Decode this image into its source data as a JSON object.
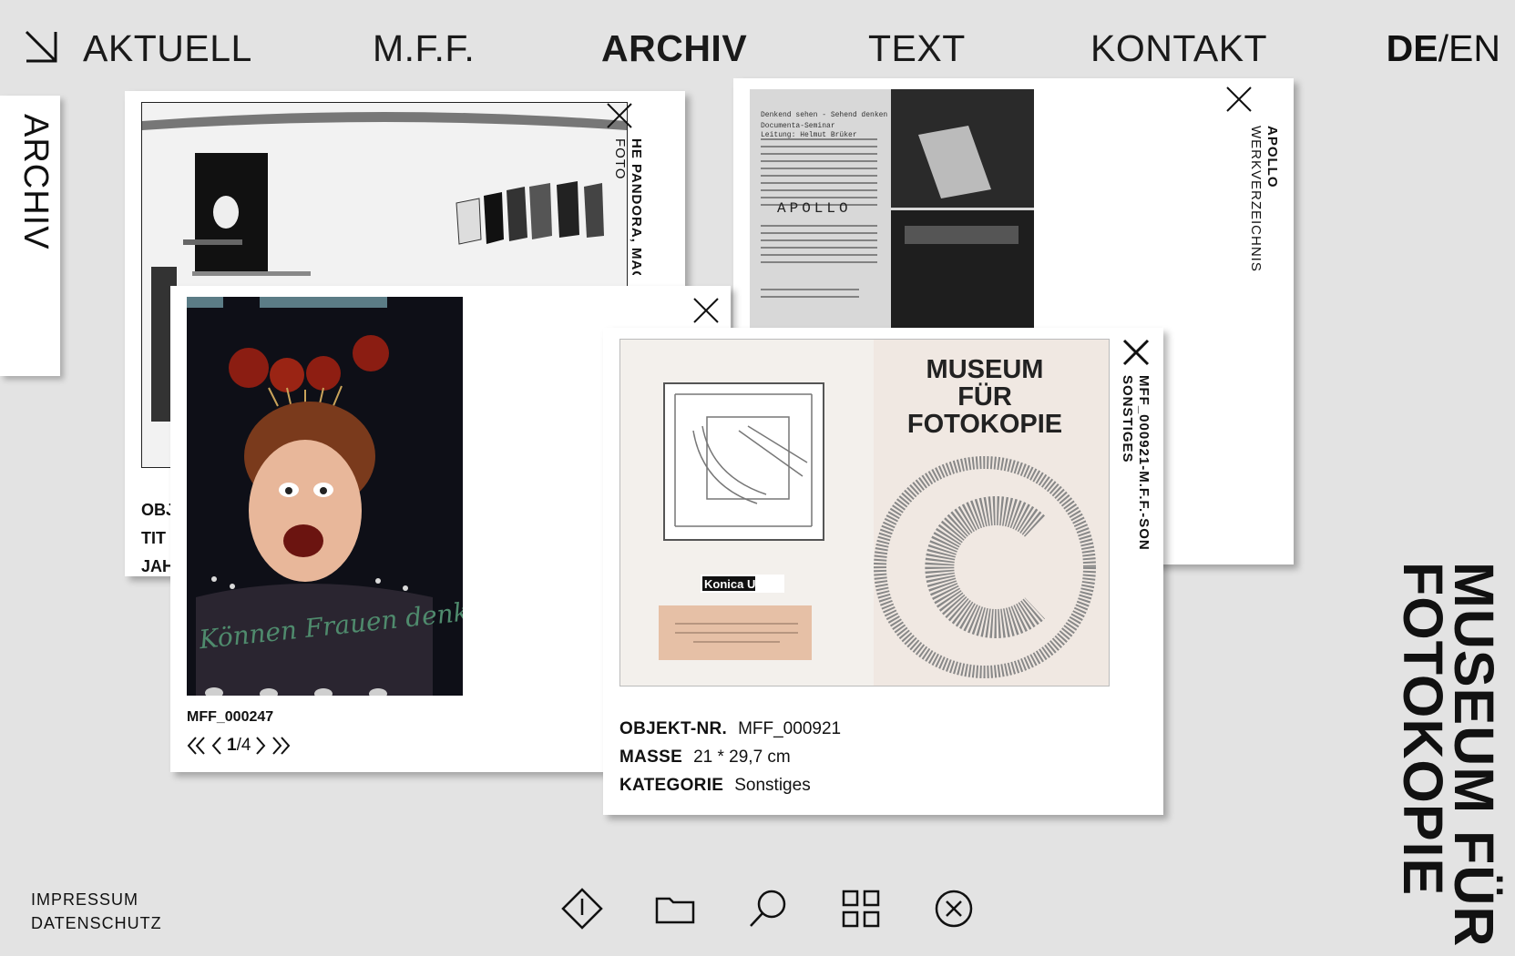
{
  "nav": {
    "items": [
      "AKTUELL",
      "M.F.F.",
      "ARCHIV",
      "TEXT",
      "KONTAKT"
    ],
    "active": "ARCHIV",
    "lang_de": "DE",
    "lang_sep": "/",
    "lang_en": "EN"
  },
  "side_tab": {
    "label": "ARCHIV"
  },
  "cards": {
    "pandora": {
      "title": "HE PANDORA, MACH",
      "subtitle": "FOTO",
      "meta": [
        "OBJ",
        "TIT",
        "JAH"
      ]
    },
    "apollo": {
      "title": "APOLLO",
      "subtitle": "WERKVERZEICHNIS",
      "doc_lines": [
        "Denkend sehen - Sehend denken",
        "Documenta-Seminar",
        "Leitung: Helmut Brüker",
        "APOLLO"
      ]
    },
    "frauen": {
      "object_nr": "MFF_000247",
      "caption": "Können Frauen denken?",
      "pager": {
        "current": "1",
        "sep": "/",
        "total": "4"
      }
    },
    "mff": {
      "title": "MFF_000921-M.F.F.-SON",
      "subtitle": "SONSTIGES",
      "object_label": "OBJEKT-NR.",
      "object_value": "MFF_000921",
      "masse_label": "MASSE",
      "masse_value": "21 * 29,7 cm",
      "kategorie_label": "KATEGORIE",
      "kategorie_value": "Sonstiges",
      "poster_title": [
        "MUSEUM",
        "FÜR",
        "FOTOKOPIE"
      ],
      "logo_text": "Konica U-BIX"
    }
  },
  "footer": {
    "impressum": "IMPRESSUM",
    "datenschutz": "DATENSCHUTZ"
  },
  "toolbar_icons": [
    "info-diamond-icon",
    "folder-icon",
    "search-icon",
    "grid-icon",
    "close-circle-icon"
  ],
  "brand": {
    "line1": "MUSEUM FÜR",
    "line2": "FOTOKOPIE"
  }
}
